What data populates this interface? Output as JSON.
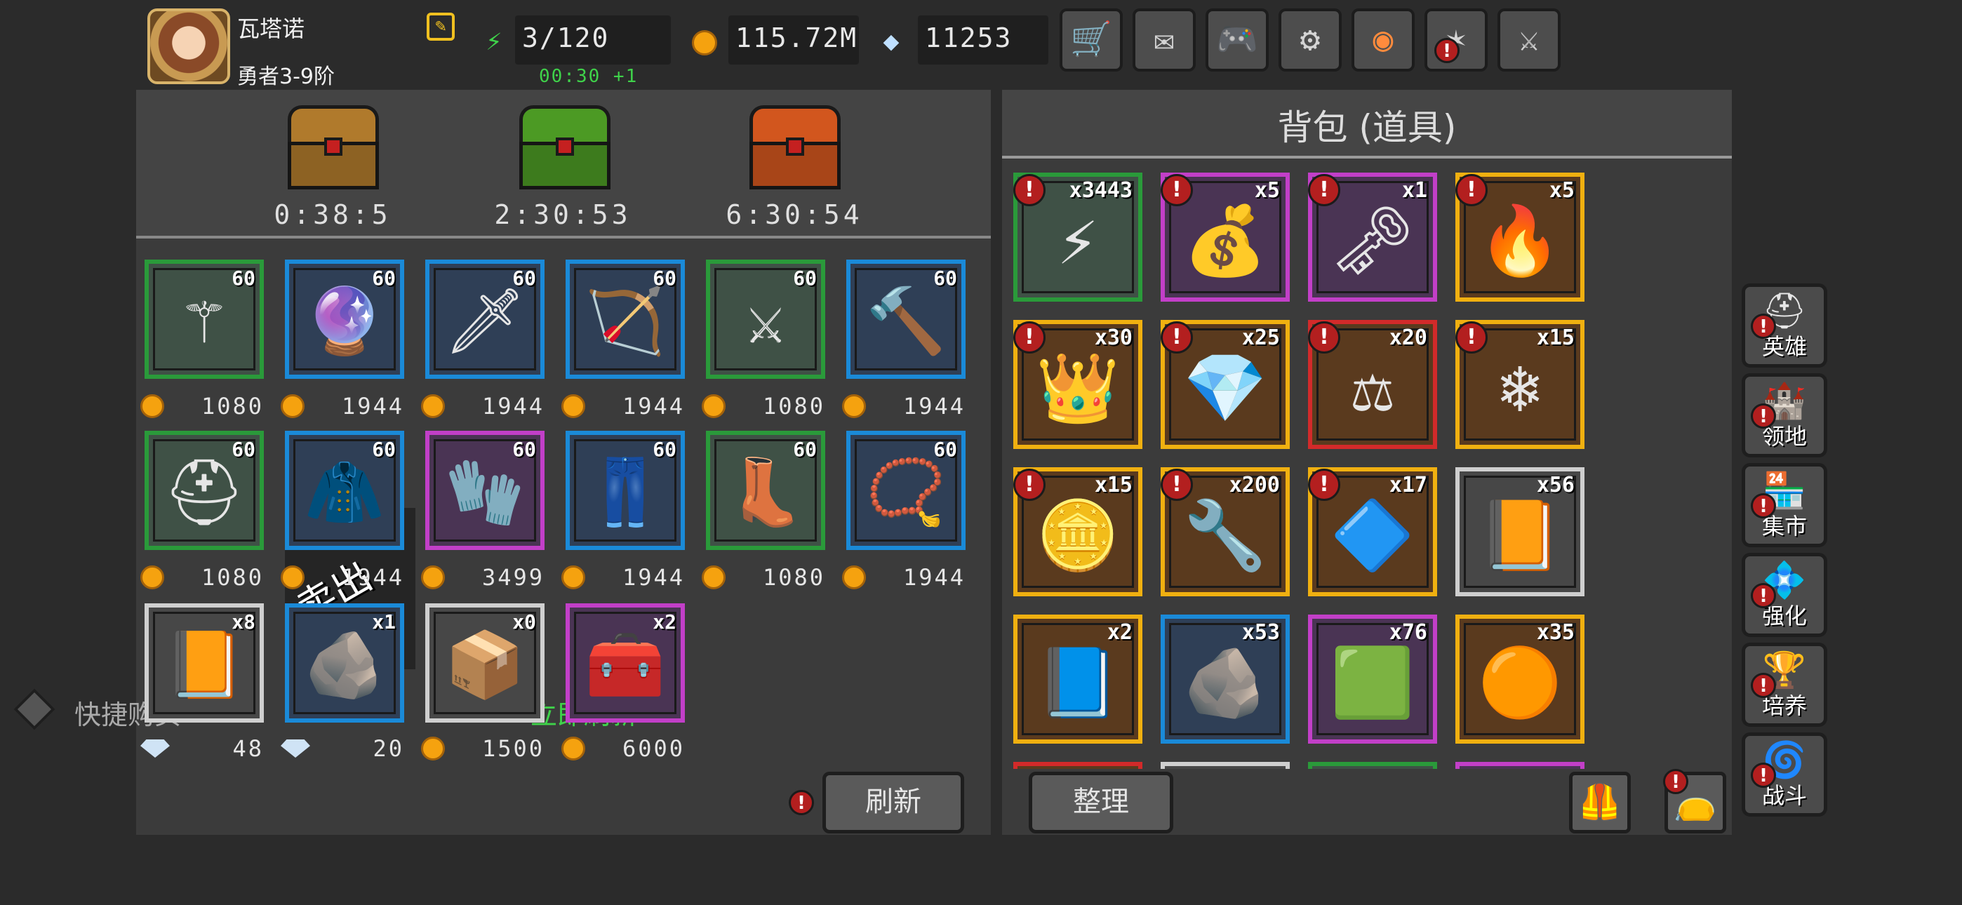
{
  "player": {
    "name": "瓦塔诺",
    "rank": "勇者3-9阶"
  },
  "resources": {
    "energy": "3/120",
    "energy_timer": "00:30 +1",
    "gold": "115.72M",
    "gems": "11253"
  },
  "toolbar": {
    "icons": [
      "cart-icon",
      "mail-icon",
      "gamepad-icon",
      "gear-icon",
      "color-wheel-icon",
      "firework-icon",
      "swords-icon"
    ],
    "glyphs": [
      "🛒",
      "✉",
      "🎮",
      "⚙",
      "◉",
      "✶",
      "⚔"
    ]
  },
  "chests": [
    {
      "timer": "0:38:5",
      "color": "#b07a2c"
    },
    {
      "timer": "2:30:53",
      "color": "#4c9a24"
    },
    {
      "timer": "6:30:54",
      "color": "#d2561e"
    }
  ],
  "shop_items": [
    {
      "level": "60",
      "rarity": "green",
      "icon": "staff-icon",
      "glyph": "⚚",
      "currency": "coin",
      "price": "1080"
    },
    {
      "level": "60",
      "rarity": "blue",
      "icon": "crystal-orb-icon",
      "glyph": "🔮",
      "currency": "coin",
      "price": "1944"
    },
    {
      "level": "60",
      "rarity": "blue",
      "icon": "dagger-icon",
      "glyph": "🗡",
      "currency": "coin",
      "price": "1944"
    },
    {
      "level": "60",
      "rarity": "blue",
      "icon": "crossbow-icon",
      "glyph": "🏹",
      "currency": "coin",
      "price": "1944"
    },
    {
      "level": "60",
      "rarity": "green",
      "icon": "curved-blade-icon",
      "glyph": "⚔",
      "currency": "coin",
      "price": "1080"
    },
    {
      "level": "60",
      "rarity": "blue",
      "icon": "mace-icon",
      "glyph": "🔨",
      "currency": "coin",
      "price": "1944"
    },
    {
      "level": "60",
      "rarity": "green",
      "icon": "helmet-icon",
      "glyph": "⛑",
      "currency": "coin",
      "price": "1080"
    },
    {
      "level": "60",
      "rarity": "blue",
      "icon": "cloak-icon",
      "glyph": "🧥",
      "currency": "coin",
      "price": "1944"
    },
    {
      "level": "60",
      "rarity": "purple",
      "icon": "gauntlets-icon",
      "glyph": "🧤",
      "currency": "coin",
      "price": "3499"
    },
    {
      "level": "60",
      "rarity": "blue",
      "icon": "leggings-icon",
      "glyph": "👖",
      "currency": "coin",
      "price": "1944"
    },
    {
      "level": "60",
      "rarity": "green",
      "icon": "boots-icon",
      "glyph": "👢",
      "currency": "coin",
      "price": "1080"
    },
    {
      "level": "60",
      "rarity": "blue",
      "icon": "amulet-icon",
      "glyph": "📿",
      "currency": "coin",
      "price": "1944"
    },
    {
      "level": "x8",
      "rarity": "white",
      "icon": "spellbook-icon",
      "glyph": "📙",
      "currency": "gem",
      "price": "48"
    },
    {
      "level": "x1",
      "rarity": "blue",
      "icon": "rune-stone-icon",
      "glyph": "🪨",
      "currency": "gem",
      "price": "20"
    },
    {
      "level": "x0",
      "rarity": "white",
      "icon": "sold-item-icon",
      "glyph": "📦",
      "currency": "coin",
      "price": "1500"
    },
    {
      "level": "x2",
      "rarity": "purple",
      "icon": "treasure-chest-icon",
      "glyph": "🧰",
      "currency": "coin",
      "price": "6000"
    }
  ],
  "shop": {
    "sold_label": "卖出",
    "quick_buy": "快捷购买",
    "refresh_now": "立即刷新",
    "refresh": "刷新"
  },
  "bag": {
    "title": "背包 (道具)",
    "sort": "整理",
    "items": [
      {
        "count": "x3443",
        "rarity": "green",
        "icon": "energy-chest-icon",
        "glyph": "⚡",
        "alert": true
      },
      {
        "count": "x5",
        "rarity": "purple",
        "icon": "loot-pile-icon",
        "glyph": "💰",
        "alert": true
      },
      {
        "count": "x1",
        "rarity": "purple",
        "icon": "loot-pile-icon",
        "glyph": "🗝",
        "alert": true
      },
      {
        "count": "x5",
        "rarity": "gold",
        "icon": "loot-pile-icon",
        "glyph": "🔥",
        "alert": true
      },
      {
        "count": "x30",
        "rarity": "gold",
        "icon": "loot-pile-icon",
        "glyph": "👑",
        "alert": true
      },
      {
        "count": "x25",
        "rarity": "gold",
        "icon": "loot-pile-icon",
        "glyph": "💎",
        "alert": true
      },
      {
        "count": "x20",
        "rarity": "red",
        "icon": "loot-pile-icon",
        "glyph": "⚖",
        "alert": true
      },
      {
        "count": "x15",
        "rarity": "gold",
        "icon": "loot-pile-icon",
        "glyph": "❄",
        "alert": true
      },
      {
        "count": "x15",
        "rarity": "gold",
        "icon": "loot-pile-icon",
        "glyph": "🪙",
        "alert": true
      },
      {
        "count": "x200",
        "rarity": "gold",
        "icon": "loot-pile-icon",
        "glyph": "🔧",
        "alert": true
      },
      {
        "count": "x17",
        "rarity": "gold",
        "icon": "loot-pile-icon",
        "glyph": "🔷",
        "alert": true
      },
      {
        "count": "x56",
        "rarity": "white",
        "icon": "spellbook-icon",
        "glyph": "📙",
        "alert": false
      },
      {
        "count": "x2",
        "rarity": "gold",
        "icon": "tome-icon",
        "glyph": "📘",
        "alert": false
      },
      {
        "count": "x53",
        "rarity": "blue",
        "icon": "rune-stone-icon",
        "glyph": "🪨",
        "alert": false
      },
      {
        "count": "x76",
        "rarity": "purple",
        "icon": "green-rune-icon",
        "glyph": "🟩",
        "alert": false
      },
      {
        "count": "x35",
        "rarity": "gold",
        "icon": "amber-rune-icon",
        "glyph": "🟠",
        "alert": false
      }
    ]
  },
  "side_nav": [
    {
      "label": "英雄",
      "icon": "hero-helmet-icon",
      "glyph": "⛑",
      "alert": true
    },
    {
      "label": "领地",
      "icon": "castle-icon",
      "glyph": "🏰",
      "alert": true
    },
    {
      "label": "集市",
      "icon": "market-icon",
      "glyph": "🏪",
      "alert": true
    },
    {
      "label": "强化",
      "icon": "enhance-icon",
      "glyph": "💠",
      "alert": true
    },
    {
      "label": "培养",
      "icon": "chalice-icon",
      "glyph": "🏆",
      "alert": true
    },
    {
      "label": "战斗",
      "icon": "portal-icon",
      "glyph": "🌀",
      "alert": true
    }
  ]
}
